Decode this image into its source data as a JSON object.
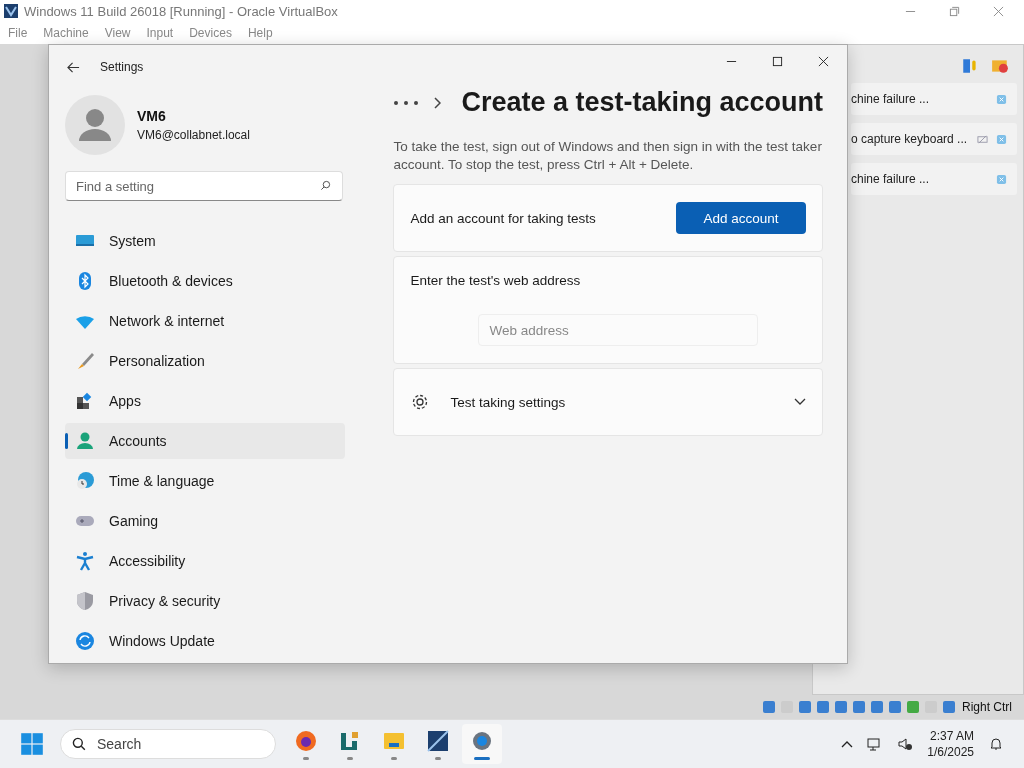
{
  "vbox": {
    "title": "Windows 11 Build 26018 [Running] - Oracle VirtualBox",
    "menu": [
      "File",
      "Machine",
      "View",
      "Input",
      "Devices",
      "Help"
    ],
    "host_key": "Right Ctrl"
  },
  "notifications": [
    {
      "text": "chine failure ...",
      "kind": "plain"
    },
    {
      "text": "o capture keyboard ...",
      "kind": "capture"
    },
    {
      "text": "chine failure ...",
      "kind": "plain"
    }
  ],
  "settings": {
    "title": "Settings",
    "user": {
      "name": "VM6",
      "email": "VM6@collabnet.local"
    },
    "search": {
      "placeholder": "Find a setting"
    },
    "nav": [
      {
        "label": "System",
        "selected": false
      },
      {
        "label": "Bluetooth & devices",
        "selected": false
      },
      {
        "label": "Network & internet",
        "selected": false
      },
      {
        "label": "Personalization",
        "selected": false
      },
      {
        "label": "Apps",
        "selected": false
      },
      {
        "label": "Accounts",
        "selected": true
      },
      {
        "label": "Time & language",
        "selected": false
      },
      {
        "label": "Gaming",
        "selected": false
      },
      {
        "label": "Accessibility",
        "selected": false
      },
      {
        "label": "Privacy & security",
        "selected": false
      },
      {
        "label": "Windows Update",
        "selected": false
      }
    ],
    "page_title": "Create a test-taking account",
    "description": "To take the test, sign out of Windows and then sign in with the test taker account. To stop the test, press Ctrl + Alt + Delete.",
    "cards": [
      {
        "kind": "action",
        "label": "Add an account for taking tests",
        "button": "Add account"
      },
      {
        "kind": "field",
        "label": "Enter the test's web address",
        "placeholder": "Web address"
      },
      {
        "kind": "expander",
        "label": "Test taking settings",
        "expanded": false
      }
    ]
  },
  "taskbar": {
    "search_placeholder": "Search",
    "apps": [
      {
        "selected": false
      },
      {
        "selected": false
      },
      {
        "selected": false
      },
      {
        "selected": false
      },
      {
        "selected": true
      }
    ],
    "time": "2:37 AM",
    "date": "1/6/2025"
  }
}
